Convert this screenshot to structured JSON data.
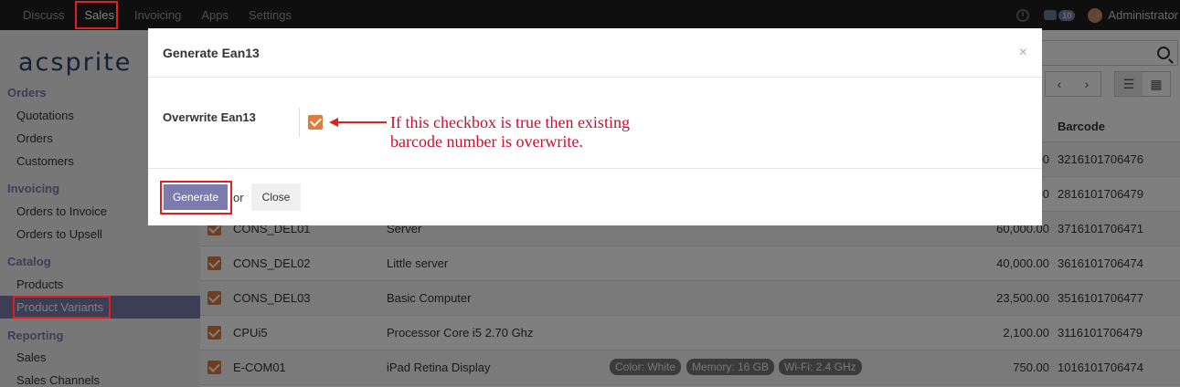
{
  "topbar": {
    "menu": [
      "Discuss",
      "Sales",
      "Invoicing",
      "Apps",
      "Settings"
    ],
    "badge": "10",
    "user": "Administrator"
  },
  "sidebar": {
    "logo": "acsprite",
    "sections": [
      {
        "title": "Orders",
        "items": [
          "Quotations",
          "Orders",
          "Customers"
        ]
      },
      {
        "title": "Invoicing",
        "items": [
          "Orders to Invoice",
          "Orders to Upsell"
        ]
      },
      {
        "title": "Catalog",
        "items": [
          "Products",
          "Product Variants"
        ]
      },
      {
        "title": "Reporting",
        "items": [
          "Sales",
          "Sales Channels"
        ]
      }
    ]
  },
  "list": {
    "barcode_header": "Barcode",
    "rows": [
      {
        "ref": "",
        "name": "",
        "price": "00",
        "barcode": "3216101706476"
      },
      {
        "ref": "",
        "name": "",
        "price": "00",
        "barcode": "2816101706479"
      },
      {
        "ref": "CONS_DEL01",
        "name": "Server",
        "price": "60,000.00",
        "barcode": "3716101706471"
      },
      {
        "ref": "CONS_DEL02",
        "name": "Little server",
        "price": "40,000.00",
        "barcode": "3616101706474"
      },
      {
        "ref": "CONS_DEL03",
        "name": "Basic Computer",
        "price": "23,500.00",
        "barcode": "3516101706477"
      },
      {
        "ref": "CPUi5",
        "name": "Processor Core i5 2.70 Ghz",
        "price": "2,100.00",
        "barcode": "3116101706479"
      },
      {
        "ref": "E-COM01",
        "name": "iPad Retina Display",
        "price": "750.00",
        "barcode": "1016101706474"
      }
    ],
    "tags": [
      "Color: White",
      "Memory: 16 GB",
      "Wi-Fi: 2.4 GHz"
    ]
  },
  "modal": {
    "title": "Generate Ean13",
    "close_icon": "×",
    "field_label": "Overwrite Ean13",
    "annotation_line1": "If this checkbox is true then existing",
    "annotation_line2": "barcode number is overwrite.",
    "generate_label": "Generate",
    "or_text": "or",
    "close_label": "Close"
  }
}
